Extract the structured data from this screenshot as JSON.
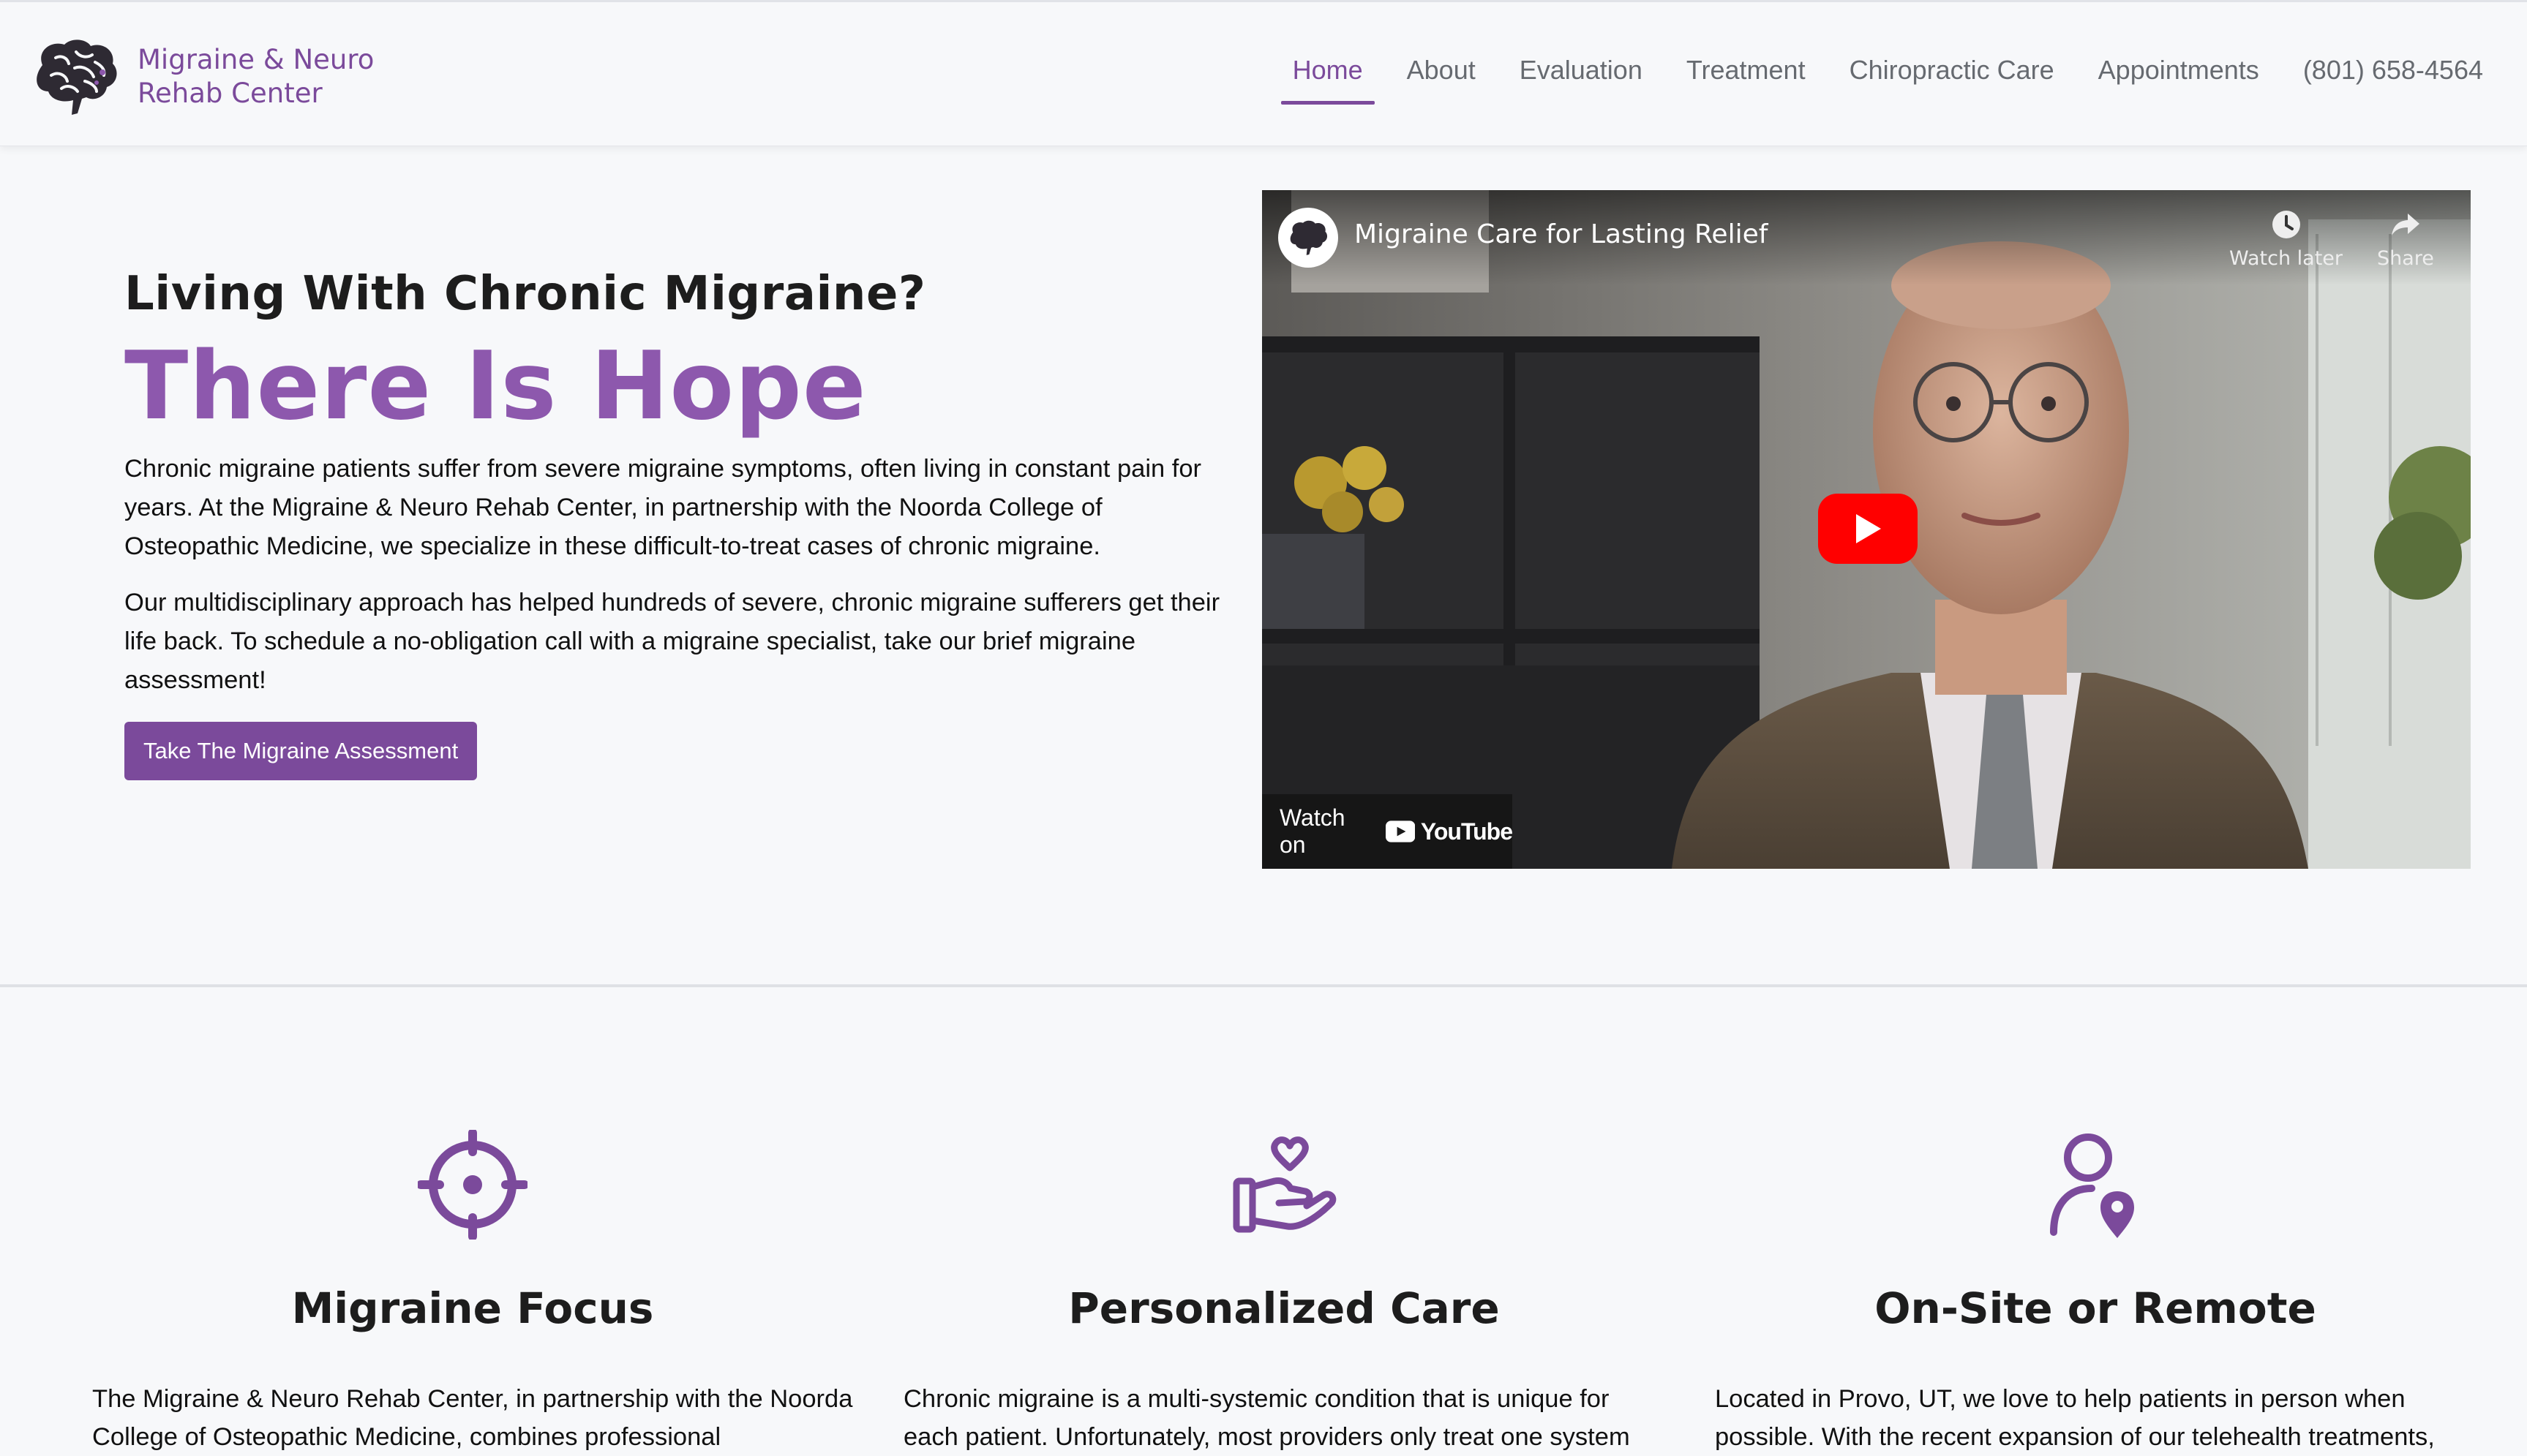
{
  "nav": {
    "brand_line1": "Migraine & Neuro",
    "brand_line2": "Rehab Center",
    "items": [
      {
        "label": "Home",
        "active": true
      },
      {
        "label": "About"
      },
      {
        "label": "Evaluation"
      },
      {
        "label": "Treatment"
      },
      {
        "label": "Chiropractic Care"
      },
      {
        "label": "Appointments"
      },
      {
        "label": "(801) 658-4564"
      }
    ]
  },
  "hero": {
    "eyebrow": "Living With Chronic Migraine?",
    "title": "There Is Hope",
    "paragraph1": "Chronic migraine patients suffer from severe migraine symptoms, often living in constant pain for years. At the Migraine & Neuro Rehab Center, in partnership with the Noorda College of Osteopathic Medicine, we specialize in these difficult-to-treat cases of chronic migraine.",
    "paragraph2": "Our multidisciplinary approach has helped hundreds of severe, chronic migraine sufferers get their life back. To schedule a no-obligation call with a migraine specialist, take our brief migraine assessment!",
    "cta_label": "Take The Migraine Assessment"
  },
  "video": {
    "title": "Migraine Care for Lasting Relief",
    "watch_later": "Watch later",
    "share": "Share",
    "watch_on": "Watch on",
    "youtube": "YouTube"
  },
  "features": [
    {
      "icon": "target-icon",
      "title": "Migraine Focus",
      "text": "The Migraine & Neuro Rehab Center, in partnership with the Noorda College of Osteopathic Medicine, combines professional"
    },
    {
      "icon": "heart-hand-icon",
      "title": "Personalized Care",
      "text": "Chronic migraine is a multi-systemic condition that is unique for each patient. Unfortunately, most providers only treat one system"
    },
    {
      "icon": "person-location-icon",
      "title": "On-Site or Remote",
      "text": "Located in Provo, UT, we love to help patients in person when possible. With the recent expansion of our telehealth treatments,"
    }
  ],
  "colors": {
    "accent": "#7b4a9b",
    "title_purple": "#8d58ad",
    "play_red": "#ff0000"
  }
}
